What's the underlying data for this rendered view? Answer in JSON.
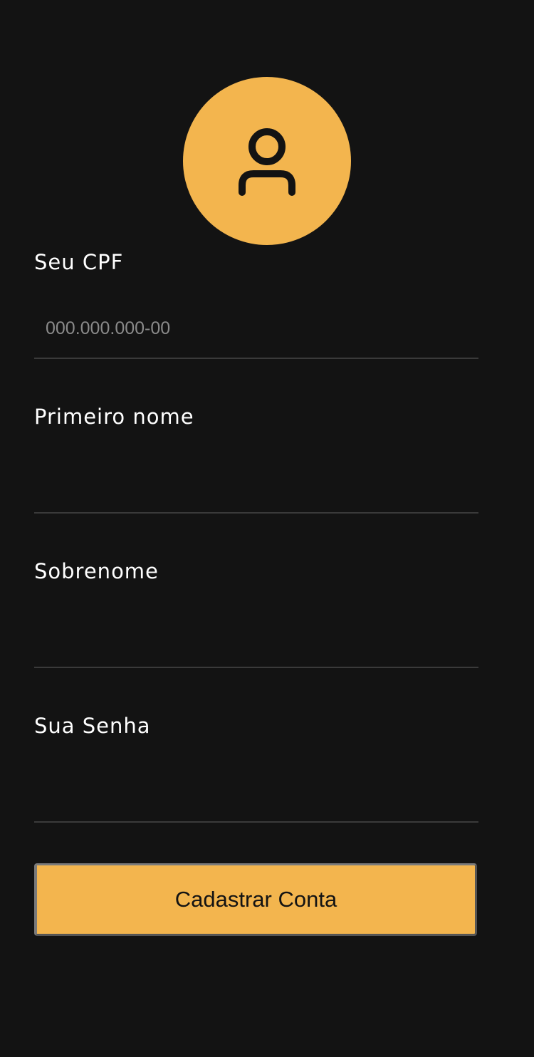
{
  "colors": {
    "background": "#131313",
    "accent": "#f3b54e",
    "text": "#ffffff",
    "divider": "#3a3a3a"
  },
  "avatar": {
    "icon": "user-icon"
  },
  "form": {
    "cpf": {
      "label": "Seu CPF",
      "placeholder": "000.000.000-00",
      "value": ""
    },
    "first_name": {
      "label": "Primeiro nome",
      "placeholder": "",
      "value": ""
    },
    "last_name": {
      "label": "Sobrenome",
      "placeholder": "",
      "value": ""
    },
    "password": {
      "label": "Sua Senha",
      "placeholder": "",
      "value": ""
    },
    "submit_label": "Cadastrar Conta"
  }
}
